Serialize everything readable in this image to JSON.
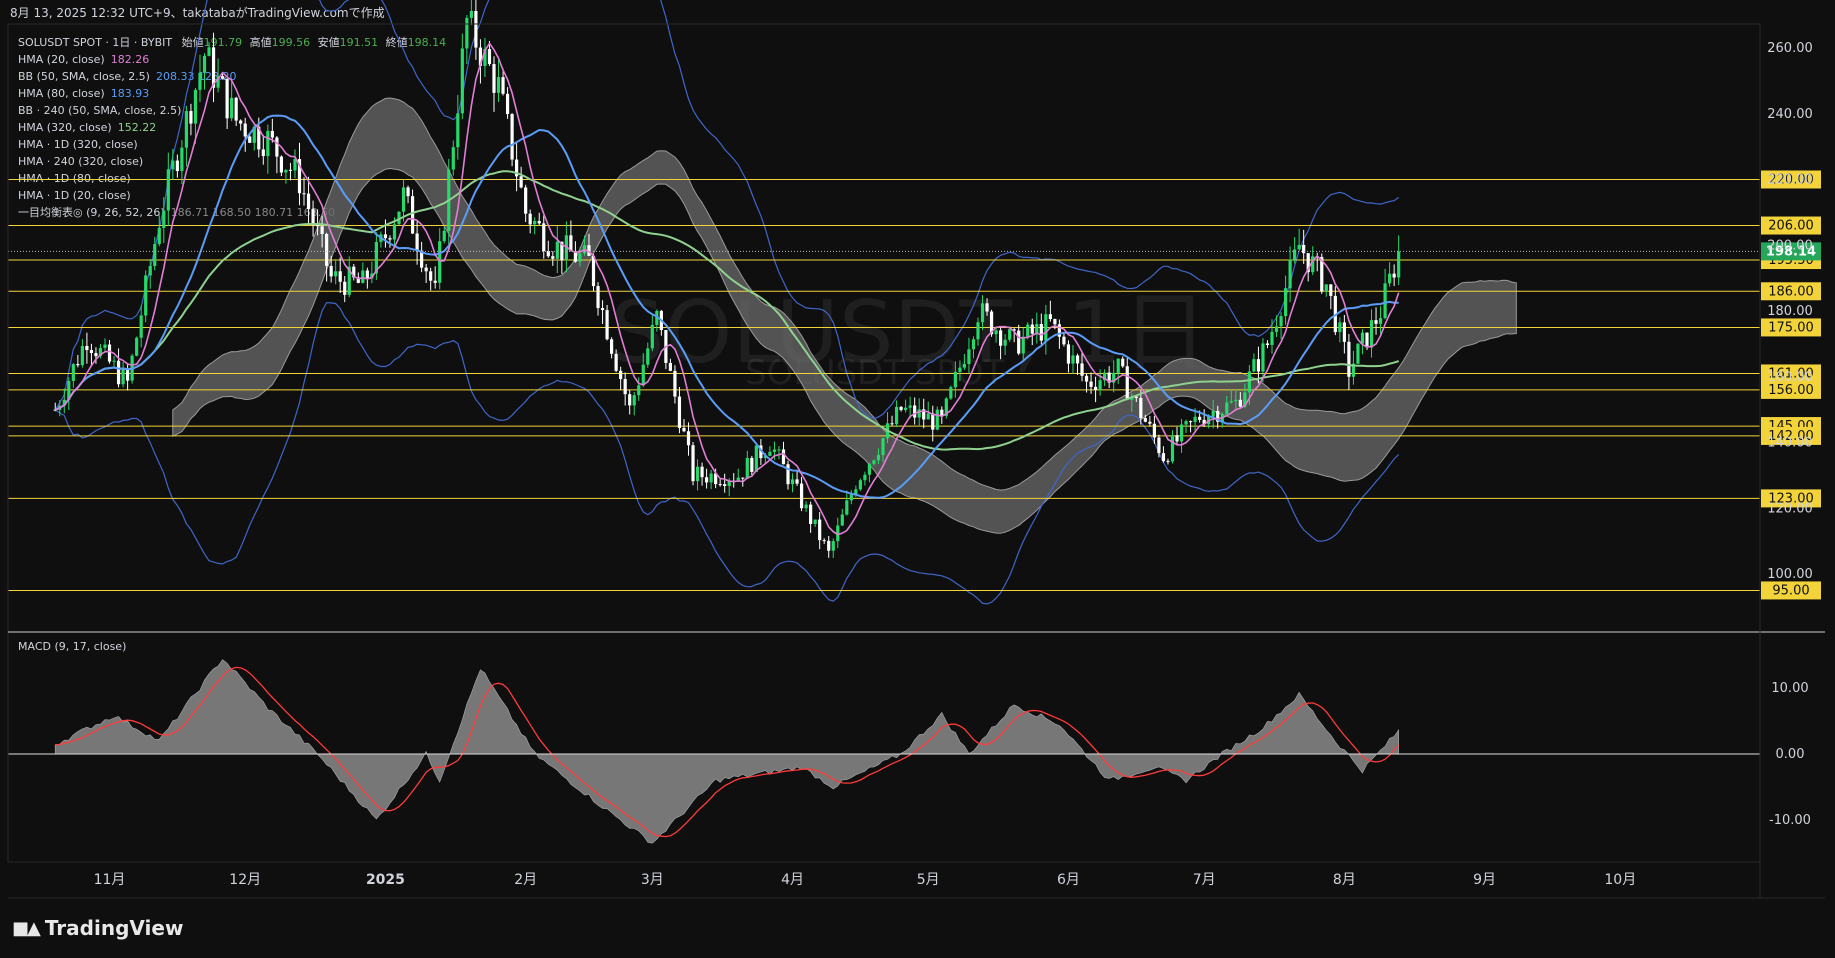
{
  "header": {
    "snapshot_info": "8月 13, 2025 12:32 UTC+9、takatabaがTradingView.comで作成"
  },
  "symbol": {
    "name": "SOLUSDT SPOT · 1日 · BYBIT",
    "open_label": "始値",
    "open": "191.79",
    "high_label": "高値",
    "high": "199.56",
    "low_label": "安値",
    "low": "191.51",
    "close_label": "終値",
    "close": "198.14"
  },
  "indicators": [
    {
      "label": "HMA (20, close)",
      "value": "182.26",
      "color": "#e17ed6"
    },
    {
      "label": "BB (50, SMA, close, 2.5)",
      "value": "208.33  128.20",
      "color": "#5b9cf6"
    },
    {
      "label": "HMA (80, close)",
      "value": "183.93",
      "color": "#5b9cf6"
    },
    {
      "label": "BB · 240 (50, SMA, close, 2.5)",
      "value": "",
      "color": "#d1d4dc"
    },
    {
      "label": "HMA (320, close)",
      "value": "152.22",
      "color": "#8fd18f"
    },
    {
      "label": "HMA · 1D (320, close)",
      "value": "",
      "color": "#d1d4dc"
    },
    {
      "label": "HMA · 240 (320, close)",
      "value": "",
      "color": "#d1d4dc"
    },
    {
      "label": "HMA · 1D (80, close)",
      "value": "",
      "color": "#d1d4dc"
    },
    {
      "label": "HMA · 1D (20, close)",
      "value": "",
      "color": "#d1d4dc"
    },
    {
      "label": "一目均衡表◎ (9, 26, 52, 26)",
      "value": "186.71  168.50  180.71  168.50",
      "color": "#888888"
    }
  ],
  "watermark": {
    "main": "SOLUSDT, 1日",
    "sub": "SOLUSDT SPOT"
  },
  "macd_label": "MACD (9, 17, close)",
  "brand": "TradingView",
  "colors": {
    "up": "#26d96a",
    "down": "#ffffff",
    "hma20": "#e17ed6",
    "hma80": "#5b9cf6",
    "hma320": "#8fd18f",
    "bb": "#3f66c8",
    "level": "#f2d43a",
    "cloud": "#6b6b6b",
    "macd_hist": "#8a8a8a",
    "signal": "#ff3b3b",
    "last_price": "#26a65b"
  },
  "chart_data": [
    {
      "type": "candlestick",
      "title": "SOLUSDT, 1日",
      "x_labels": [
        "11月",
        "12月",
        "2025",
        "2月",
        "3月",
        "4月",
        "5月",
        "6月",
        "7月",
        "8月",
        "9月",
        "10月"
      ],
      "y_ticks": [
        100,
        120,
        140,
        160,
        180,
        200,
        220,
        240,
        260
      ],
      "y_tick_labels": [
        "100.00",
        "120.00",
        "140.00",
        "160.00",
        "180.00",
        "200.00",
        "220.00",
        "240.00",
        "260.00"
      ],
      "ylim": [
        80,
        270
      ],
      "horizontal_levels": [
        220,
        206,
        195.5,
        186,
        175,
        161,
        156,
        145,
        142,
        123,
        95
      ],
      "level_labels": [
        "220.00",
        "206.00",
        "195.50",
        "186.00",
        "175.00",
        "161.00",
        "156.00",
        "145.00",
        "142.00",
        "123.00",
        "95.00"
      ],
      "last_price": 198.14,
      "last_price_label": "198.14",
      "close_path": [
        [
          "2024-10-20",
          150
        ],
        [
          "2024-10-27",
          172
        ],
        [
          "2024-11-05",
          158
        ],
        [
          "2024-11-12",
          208
        ],
        [
          "2024-11-22",
          258
        ],
        [
          "2024-11-29",
          238
        ],
        [
          "2024-12-06",
          232
        ],
        [
          "2024-12-13",
          220
        ],
        [
          "2024-12-20",
          190
        ],
        [
          "2024-12-27",
          188
        ],
        [
          "2025-01-05",
          215
        ],
        [
          "2025-01-12",
          185
        ],
        [
          "2025-01-19",
          268
        ],
        [
          "2025-01-26",
          248
        ],
        [
          "2025-02-01",
          210
        ],
        [
          "2025-02-07",
          200
        ],
        [
          "2025-02-15",
          195
        ],
        [
          "2025-02-24",
          150
        ],
        [
          "2025-03-02",
          178
        ],
        [
          "2025-03-10",
          130
        ],
        [
          "2025-03-20",
          130
        ],
        [
          "2025-03-27",
          140
        ],
        [
          "2025-04-03",
          122
        ],
        [
          "2025-04-09",
          106
        ],
        [
          "2025-04-15",
          128
        ],
        [
          "2025-04-25",
          150
        ],
        [
          "2025-05-04",
          146
        ],
        [
          "2025-05-12",
          180
        ],
        [
          "2025-05-20",
          170
        ],
        [
          "2025-05-28",
          176
        ],
        [
          "2025-06-05",
          158
        ],
        [
          "2025-06-12",
          162
        ],
        [
          "2025-06-22",
          136
        ],
        [
          "2025-06-30",
          148
        ],
        [
          "2025-07-08",
          152
        ],
        [
          "2025-07-15",
          170
        ],
        [
          "2025-07-22",
          200
        ],
        [
          "2025-07-28",
          188
        ],
        [
          "2025-08-02",
          162
        ],
        [
          "2025-08-09",
          180
        ],
        [
          "2025-08-13",
          198.14
        ]
      ],
      "series": [
        {
          "name": "HMA (20, close)",
          "last": 182.26
        },
        {
          "name": "HMA (80, close)",
          "last": 183.93
        },
        {
          "name": "HMA (320, close)",
          "last": 152.22
        },
        {
          "name": "BB (50, SMA, close, 2.5)",
          "upper": 208.33,
          "lower": 128.2
        }
      ]
    },
    {
      "type": "area",
      "title": "MACD (9, 17, close)",
      "y_ticks": [
        10,
        0,
        -10
      ],
      "y_tick_labels": [
        "10.00",
        "0.00",
        "-10.00"
      ],
      "ylim": [
        -17,
        18
      ],
      "macd_path": [
        [
          "2024-10-20",
          1.5
        ],
        [
          "2024-11-02",
          5.8
        ],
        [
          "2024-11-12",
          2
        ],
        [
          "2024-11-26",
          14.5
        ],
        [
          "2024-12-06",
          7
        ],
        [
          "2024-12-17",
          0
        ],
        [
          "2024-12-30",
          -10
        ],
        [
          "2025-01-10",
          0
        ],
        [
          "2025-01-13",
          -4
        ],
        [
          "2025-01-22",
          13
        ],
        [
          "2025-02-03",
          0
        ],
        [
          "2025-02-18",
          -8
        ],
        [
          "2025-03-01",
          -13.5
        ],
        [
          "2025-03-15",
          -4
        ],
        [
          "2025-04-03",
          -2
        ],
        [
          "2025-04-10",
          -5
        ],
        [
          "2025-04-25",
          0
        ],
        [
          "2025-05-04",
          6
        ],
        [
          "2025-05-10",
          0
        ],
        [
          "2025-05-20",
          7.5
        ],
        [
          "2025-05-30",
          4.5
        ],
        [
          "2025-06-10",
          -4
        ],
        [
          "2025-06-20",
          -2
        ],
        [
          "2025-06-27",
          -4
        ],
        [
          "2025-07-05",
          0
        ],
        [
          "2025-07-14",
          4
        ],
        [
          "2025-07-22",
          9
        ],
        [
          "2025-07-30",
          2
        ],
        [
          "2025-08-05",
          -2.5
        ],
        [
          "2025-08-13",
          3.5
        ]
      ]
    }
  ]
}
